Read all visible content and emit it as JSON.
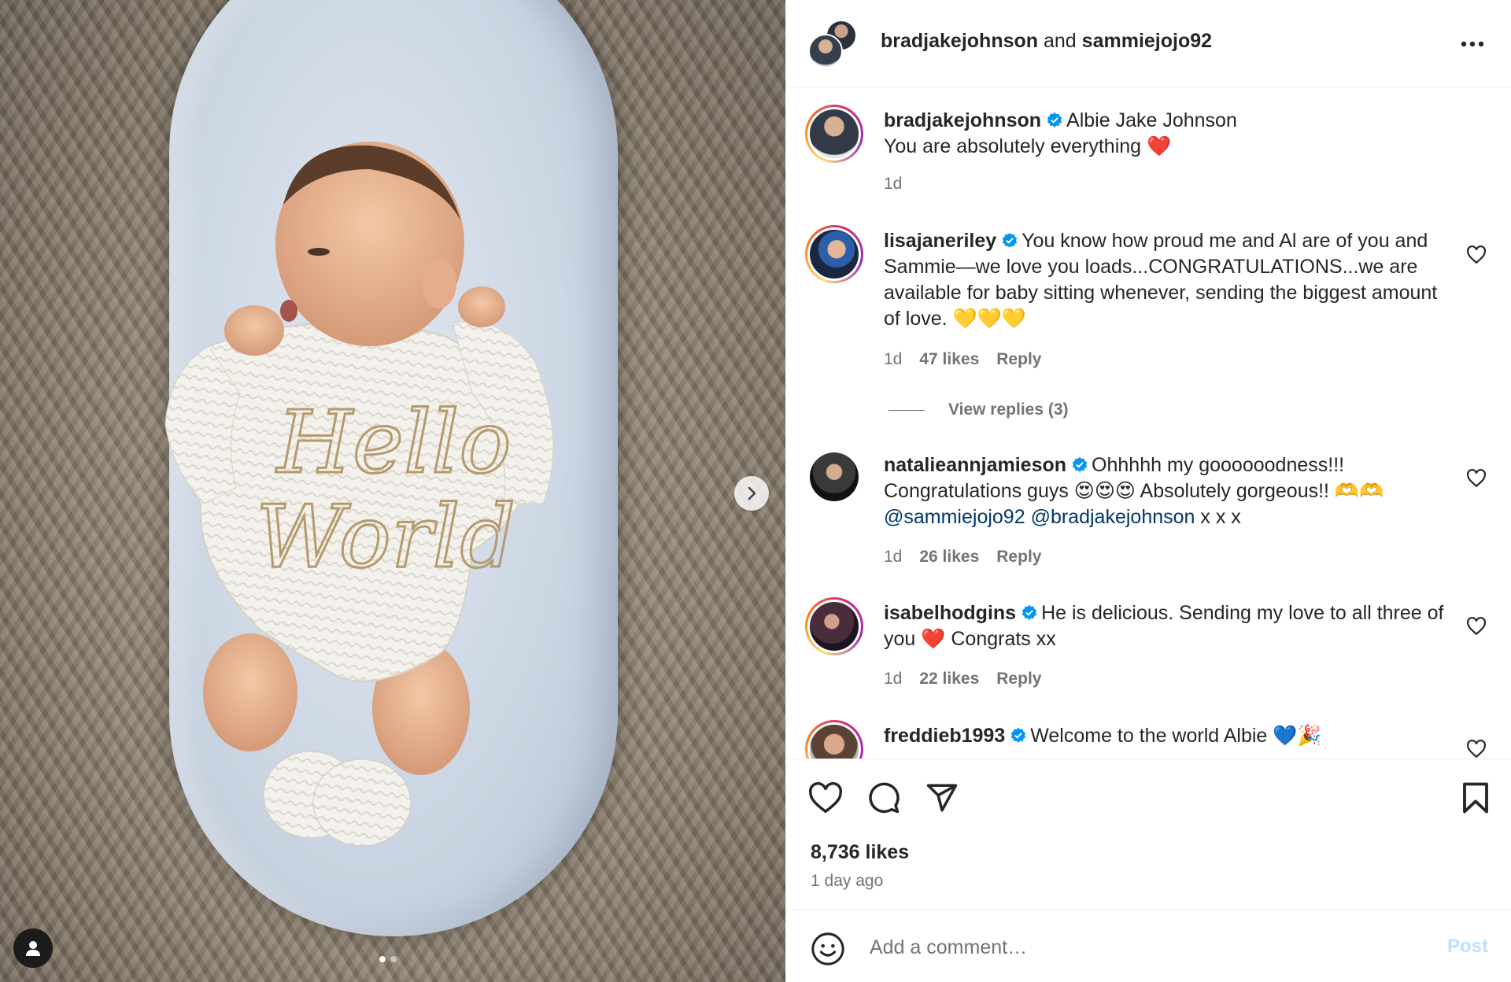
{
  "header": {
    "user1": "bradjakejohnson",
    "conjunction": "and",
    "user2": "sammiejojo92"
  },
  "caption": {
    "username": "bradjakejohnson",
    "line1": "Albie Jake Johnson",
    "line2": "You are absolutely everything",
    "emoji": "❤️",
    "time": "1d"
  },
  "comments": [
    {
      "username": "lisajaneriley",
      "text": "You know how proud me and Al are of you and Sammie—we love you loads...CONGRATULATIONS...we are available for baby sitting whenever, sending the biggest amount of love. 💛💛💛",
      "time": "1d",
      "likes": "47 likes",
      "reply": "Reply",
      "view_replies": "View replies (3)"
    },
    {
      "username": "natalieannjamieson",
      "text_part1": "Ohhhhh my goooooodness!!! Congratulations guys 😍😍😍 Absolutely gorgeous!! 🫶🫶",
      "mention1": "@sammiejojo92",
      "mention2": "@bradjakejohnson",
      "text_part2": "x x x",
      "time": "1d",
      "likes": "26 likes",
      "reply": "Reply"
    },
    {
      "username": "isabelhodgins",
      "text_part1": "He is delicious. Sending my love to all three of you",
      "emoji": "❤️",
      "text_part2": "Congrats xx",
      "time": "1d",
      "likes": "22 likes",
      "reply": "Reply"
    },
    {
      "username": "freddieb1993",
      "text": "Welcome to the world Albie 💙🎉"
    }
  ],
  "post": {
    "likes": "8,736 likes",
    "time_ago": "1 day ago"
  },
  "comment_bar": {
    "placeholder": "Add a comment…",
    "post_label": "Post"
  },
  "photo": {
    "garment_text": "Hello World",
    "carousel_total": 2,
    "carousel_index": 1
  },
  "colors": {
    "link": "#00376b",
    "muted": "#737373",
    "verified": "#0095f6",
    "post_disabled": "#c0dffd"
  }
}
